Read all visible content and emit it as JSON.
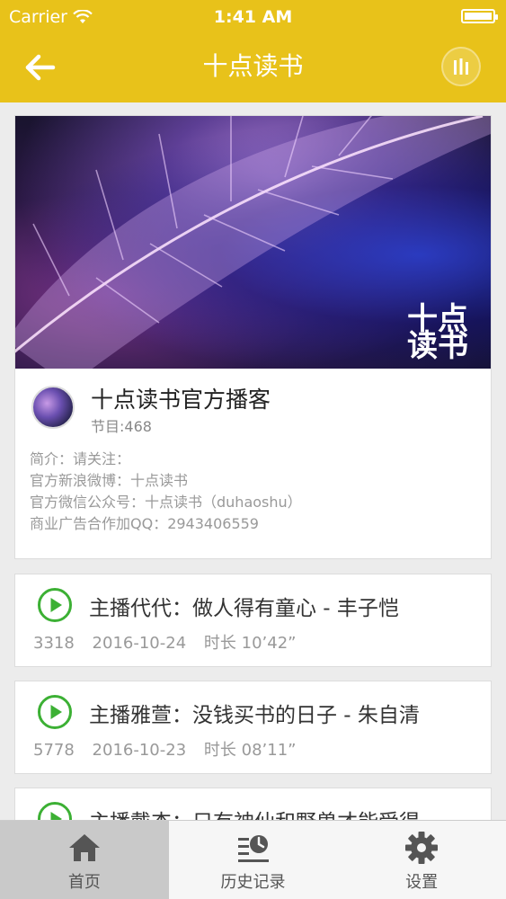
{
  "status_bar": {
    "carrier": "Carrier",
    "time": "1:41 AM",
    "battery_level": 1.0
  },
  "nav": {
    "title": "十点读书",
    "back_icon": "back-arrow-icon",
    "player_icon": "now-playing-icon"
  },
  "podcast": {
    "cover_mark": "十点读书",
    "title": "十点读书官方播客",
    "count_label": "节目:468",
    "description": [
      "简介：请关注：",
      "官方新浪微博：十点读书",
      "官方微信公众号：十点读书（duhaoshu）",
      "商业广告合作加QQ：2943406559"
    ]
  },
  "episodes": [
    {
      "title": "主播代代：做人得有童心 - 丰子恺",
      "plays": "3318",
      "date": "2016-10-24",
      "duration": "时长 10’42”"
    },
    {
      "title": "主播雅萱：没钱买书的日子 - 朱自清",
      "plays": "5778",
      "date": "2016-10-23",
      "duration": "时长 08’11”"
    },
    {
      "title": "主播戴杰：只有神仙和野兽才能受得",
      "plays": "",
      "date": "",
      "duration": ""
    }
  ],
  "tabbar": [
    {
      "label": "首页",
      "icon": "home-icon",
      "active": true
    },
    {
      "label": "历史记录",
      "icon": "history-icon",
      "active": false
    },
    {
      "label": "设置",
      "icon": "gear-icon",
      "active": false
    }
  ],
  "colors": {
    "accent": "#e8c21a",
    "play_green": "#3cb034"
  }
}
